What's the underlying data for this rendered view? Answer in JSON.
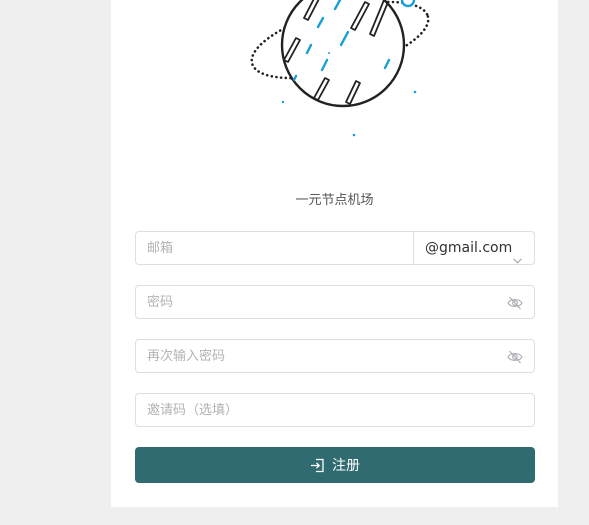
{
  "brand": {
    "site_name": "一元节点机场",
    "accent_color": "#1a9fd6",
    "button_color": "#2f6b71"
  },
  "form": {
    "email": {
      "placeholder": "邮箱",
      "domain_suffix": "@gmail.com",
      "domain_icon": "chevron-down-icon"
    },
    "password": {
      "placeholder": "密码",
      "icon": "eye-off-icon"
    },
    "confirm_password": {
      "placeholder": "再次输入密码",
      "icon": "eye-off-icon"
    },
    "invite_code": {
      "placeholder": "邀请码（选填）"
    },
    "register_button": {
      "label": "注册",
      "icon": "sign-in-icon"
    }
  }
}
